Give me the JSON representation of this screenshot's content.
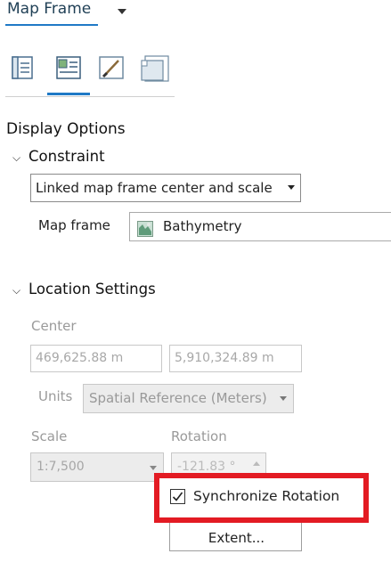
{
  "header": {
    "title": "Map Frame"
  },
  "tools": [
    {
      "icon": "list-options-icon"
    },
    {
      "icon": "display-options-icon",
      "selected": true
    },
    {
      "icon": "symbology-brush-icon"
    },
    {
      "icon": "frame-placement-icon"
    }
  ],
  "display_options": {
    "heading": "Display Options"
  },
  "constraint": {
    "heading": "Constraint",
    "mode_value": "Linked map frame center and scale",
    "map_frame_label": "Map frame",
    "map_frame_value": "Bathymetry"
  },
  "location": {
    "heading": "Location Settings",
    "center_label": "Center",
    "center_x": "469,625.88 m",
    "center_y": "5,910,324.89 m",
    "units_label": "Units",
    "units_value": "Spatial Reference (Meters)",
    "scale_label": "Scale",
    "scale_value": "1:7,500",
    "rotation_label": "Rotation",
    "rotation_value": "-121.83 °"
  },
  "popup": {
    "sync_label": "Synchronize Rotation",
    "sync_checked": true,
    "extent_label": "Extent..."
  },
  "colors": {
    "accent": "#1f79c6",
    "highlight_border": "#e31b23"
  }
}
